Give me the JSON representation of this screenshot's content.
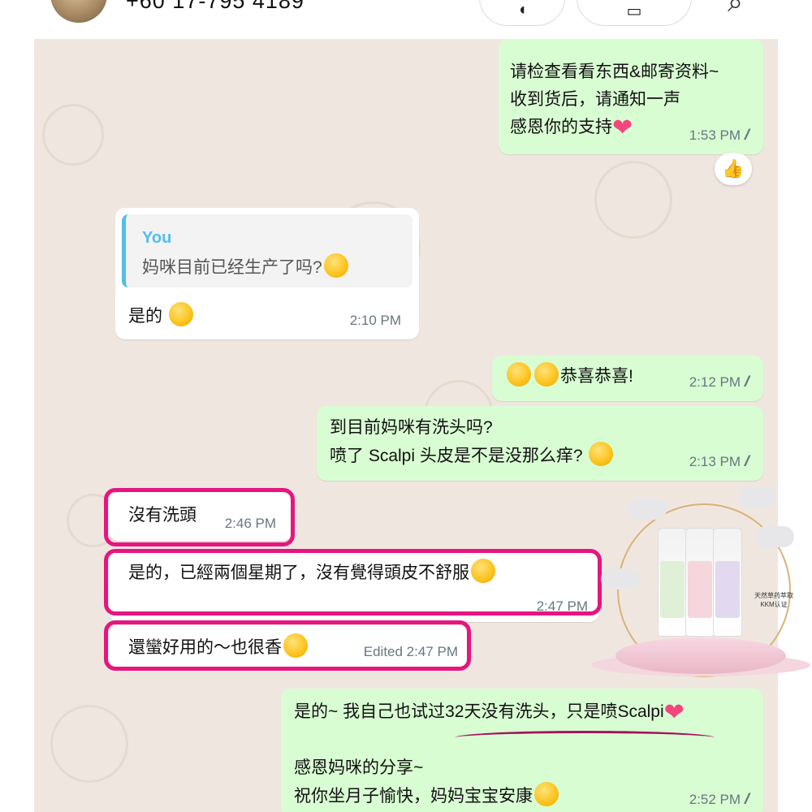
{
  "header": {
    "contact_phone": "+60 17-795 4189"
  },
  "messages": [
    {
      "id": "m1",
      "dir": "out",
      "lines": [
        "请检查看看东西&邮寄资料~",
        "收到货后，请通知一声",
        "感恩你的支持"
      ],
      "time": "1:53 PM",
      "reaction": "👍"
    },
    {
      "id": "m2",
      "dir": "in",
      "quote_author": "You",
      "quote_text": "妈咪目前已经生产了吗?",
      "text": "是的",
      "time": "2:10 PM"
    },
    {
      "id": "m3",
      "dir": "out",
      "text": "恭喜恭喜!",
      "time": "2:12 PM"
    },
    {
      "id": "m4",
      "dir": "out",
      "lines": [
        "到目前妈咪有洗头吗?",
        "喷了 Scalpi 头皮是不是没那么痒?"
      ],
      "time": "2:13 PM"
    },
    {
      "id": "m5",
      "dir": "in",
      "text": "沒有洗頭",
      "time": "2:46 PM"
    },
    {
      "id": "m6",
      "dir": "in",
      "text": "是的，已經兩個星期了，沒有覺得頭皮不舒服",
      "time": "2:47 PM"
    },
    {
      "id": "m7",
      "dir": "in",
      "text": "還蠻好用的～也很香",
      "time": "Edited 2:47 PM"
    },
    {
      "id": "m8",
      "dir": "out",
      "lines": [
        "是的~ 我自己也试过32天没有洗头，只是喷Scalpi",
        "感恩妈咪的分享~",
        "祝你坐月子愉快，妈妈宝宝安康"
      ],
      "time": "2:52 PM"
    }
  ],
  "product_overlay": {
    "brand": "Scalpi",
    "cert_line1": "天然草药萃取",
    "cert_line2": "KKM认证"
  },
  "colors": {
    "outgoing_bubble": "#d9fdd3",
    "incoming_bubble": "#ffffff",
    "chat_background": "#efe7df",
    "highlight": "#e6157f",
    "quote_accent": "#53bdeb"
  }
}
